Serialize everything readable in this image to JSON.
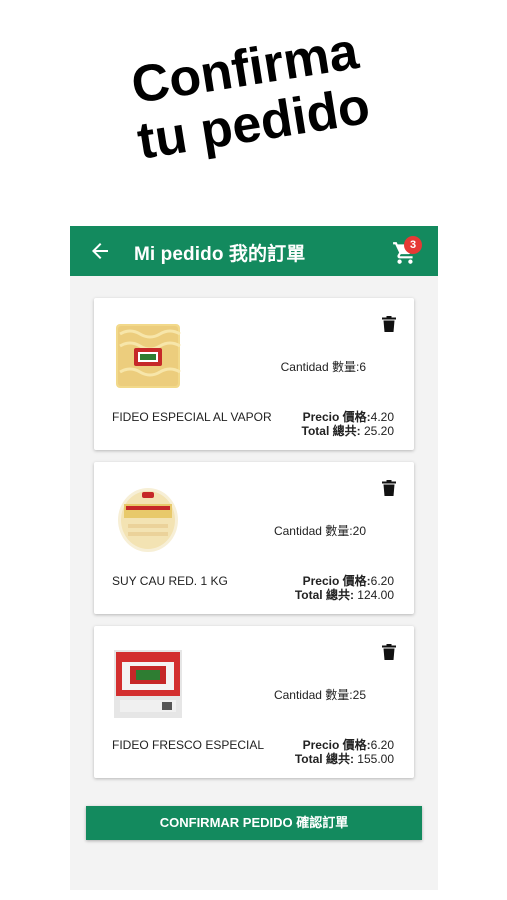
{
  "promo": {
    "line1": "Confirma",
    "line2": "tu pedido"
  },
  "appbar": {
    "back_icon": "arrow-left-icon",
    "title": "Mi pedido 我的訂單",
    "cart_icon": "shopping-cart-icon",
    "cart_count": "3",
    "color": "#138a5e",
    "badge_color": "#e53935"
  },
  "items": [
    {
      "name": "FIDEO ESPECIAL AL VAPOR",
      "quantity_label": "Cantidad 數量:6",
      "price_label": "Precio 價格:",
      "price_value": "4.20",
      "total_label": "Total 總共:",
      "total_value": "25.20",
      "image_icon": "noodle-package-yellow"
    },
    {
      "name": "SUY CAU RED. 1 KG",
      "quantity_label": "Cantidad 數量:20",
      "price_label": "Precio 價格:",
      "price_value": "6.20",
      "total_label": "Total 總共:",
      "total_value": "124.00",
      "image_icon": "noodle-package-round"
    },
    {
      "name": "FIDEO FRESCO ESPECIAL",
      "quantity_label": "Cantidad 數量:25",
      "price_label": "Precio 價格:",
      "price_value": "6.20",
      "total_label": "Total 總共:",
      "total_value": "155.00",
      "image_icon": "noodle-package-red"
    }
  ],
  "confirm_button": {
    "label": "CONFIRMAR PEDIDO 確認訂單"
  }
}
